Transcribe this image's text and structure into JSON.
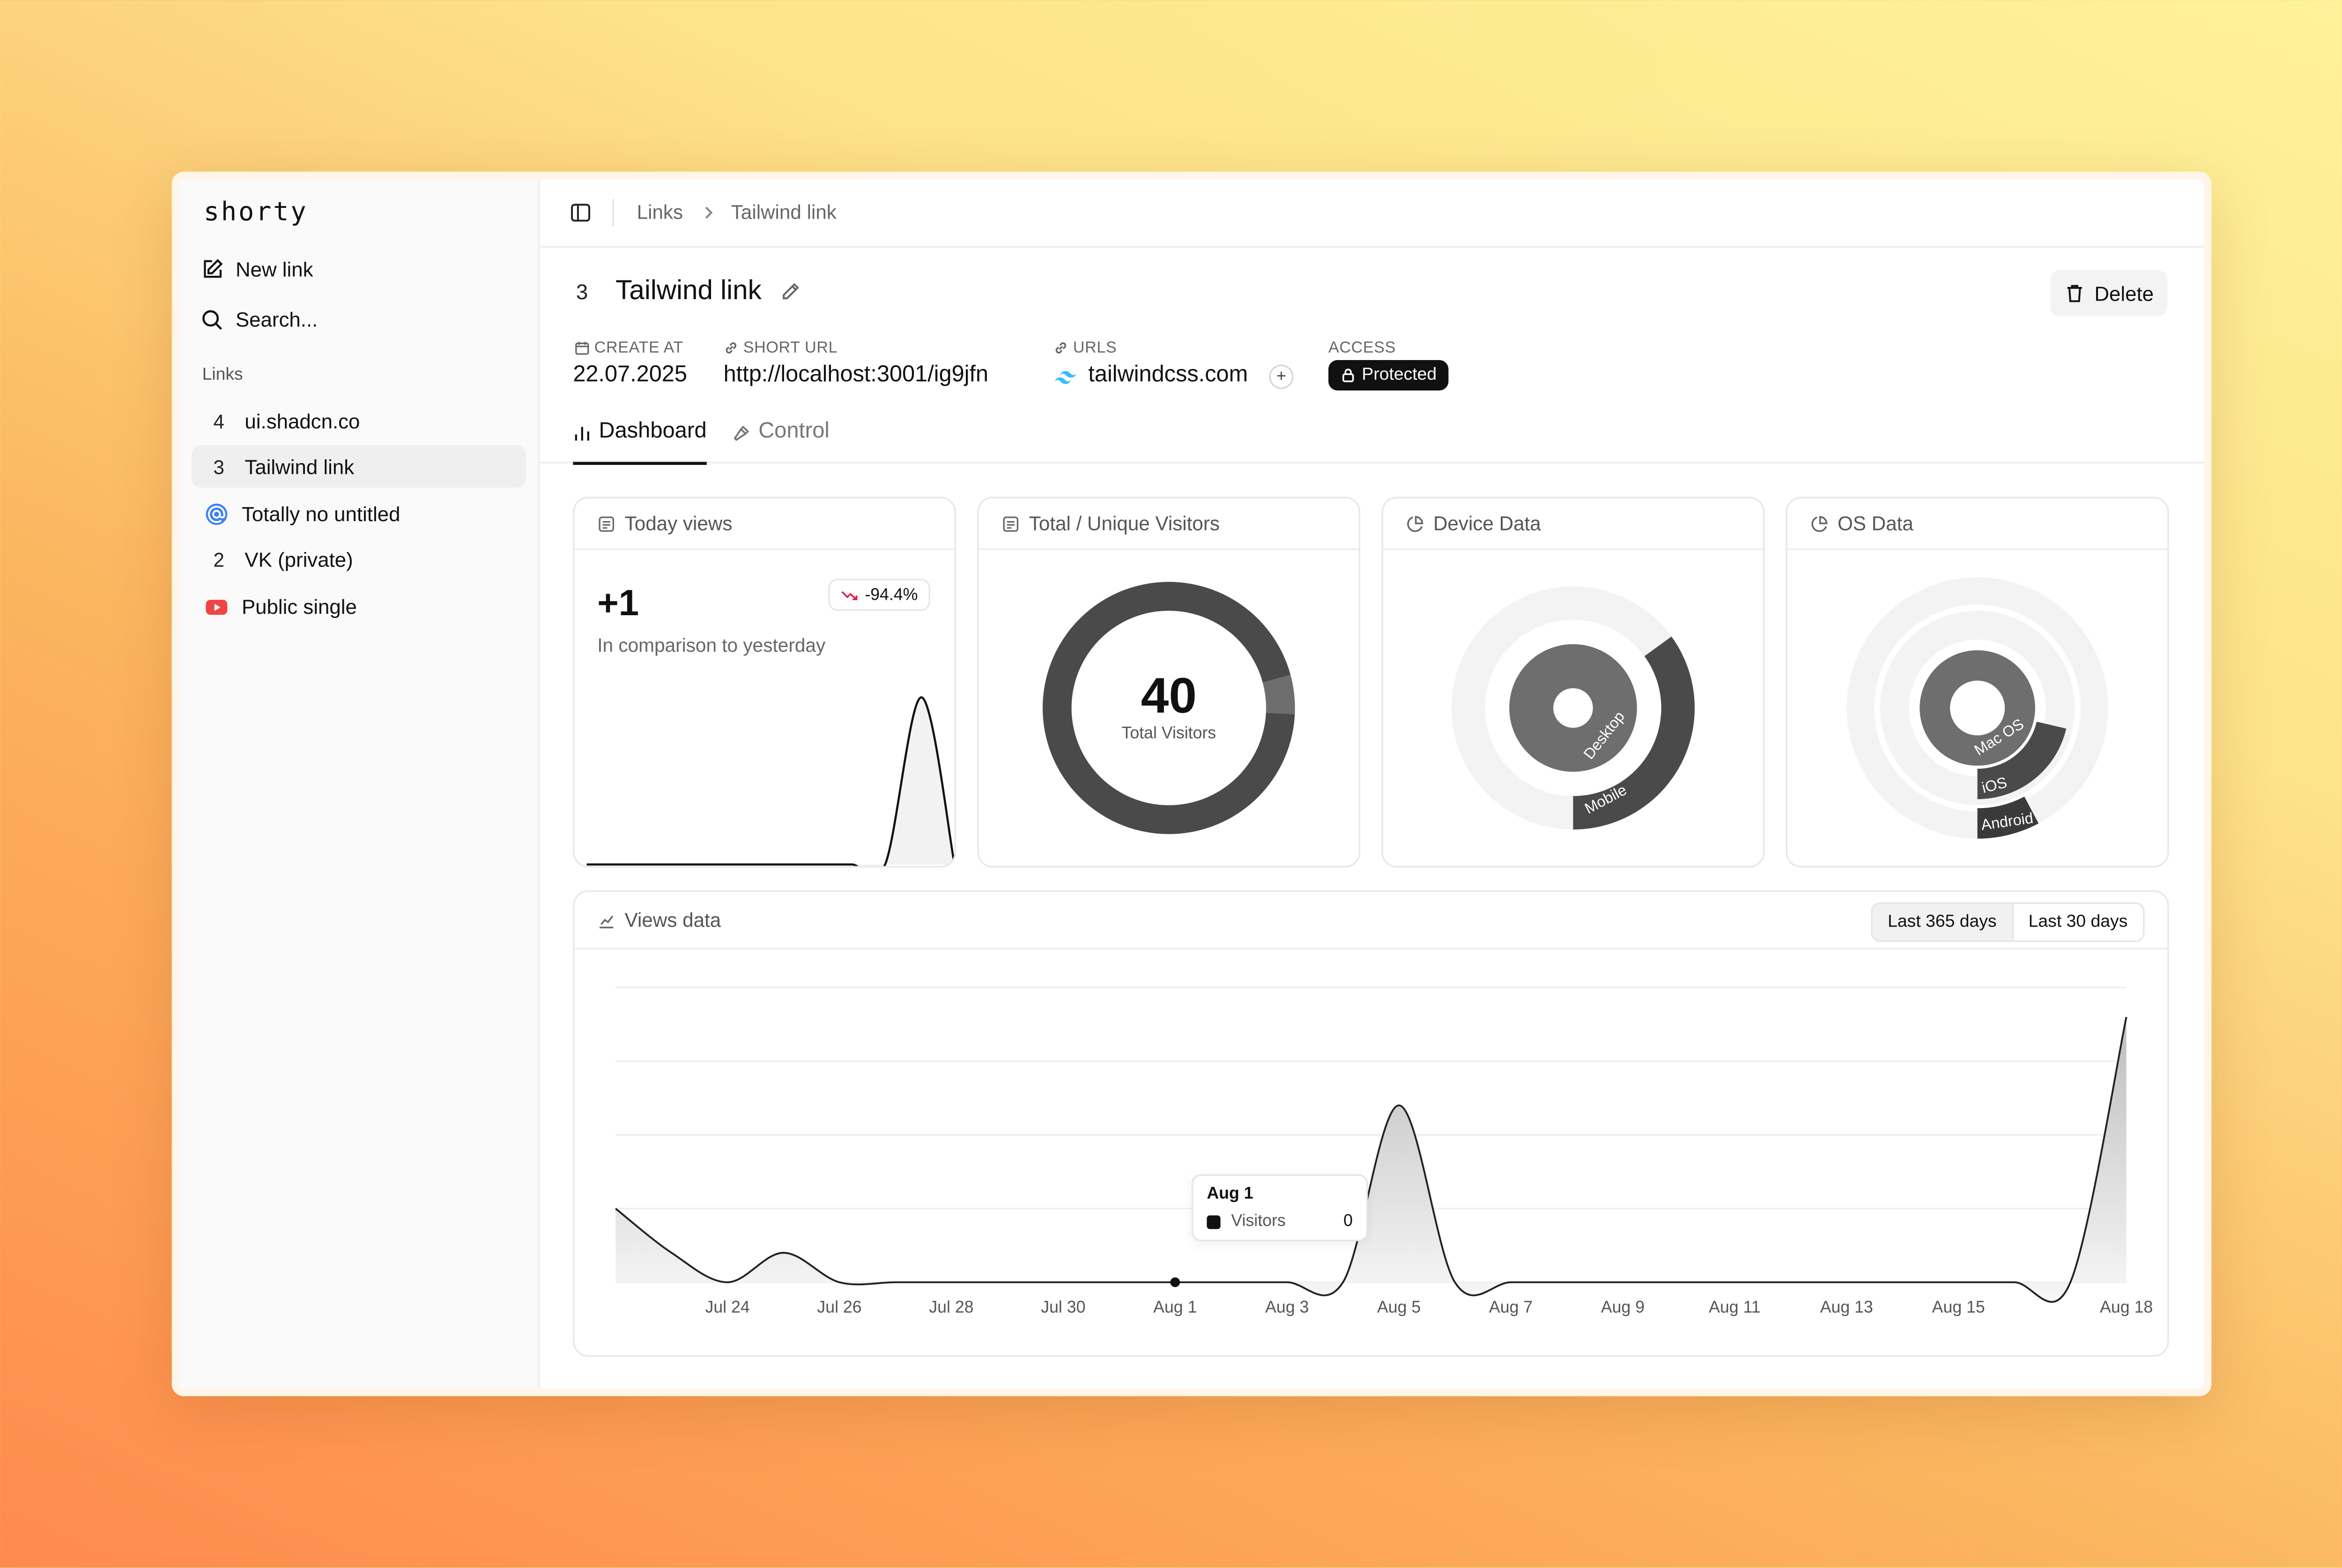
{
  "app": {
    "brand": "shorty"
  },
  "sidebar": {
    "new_link": "New link",
    "search": "Search...",
    "group_label": "Links",
    "items": [
      {
        "badge": "4",
        "label": "ui.shadcn.co",
        "icon": "number"
      },
      {
        "badge": "3",
        "label": "Tailwind link",
        "icon": "number",
        "active": true
      },
      {
        "badge": "",
        "label": "Totally no untitled",
        "icon": "at-sign-icon"
      },
      {
        "badge": "2",
        "label": "VK (private)",
        "icon": "number"
      },
      {
        "badge": "",
        "label": "Public single",
        "icon": "youtube-icon"
      }
    ]
  },
  "breadcrumb": {
    "parent": "Links",
    "current": "Tailwind link"
  },
  "link": {
    "number": "3",
    "title": "Tailwind link",
    "delete_label": "Delete",
    "meta": {
      "create_label": "CREATE AT",
      "create_value": "22.07.2025",
      "short_label": "SHORT URL",
      "short_value": "http://localhost:3001/ig9jfn",
      "urls_label": "URLS",
      "urls_value": "tailwindcss.com",
      "access_label": "ACCESS",
      "access_value": "Protected"
    }
  },
  "tabs": [
    {
      "label": "Dashboard",
      "active": true
    },
    {
      "label": "Control",
      "active": false
    }
  ],
  "cards": {
    "today": {
      "title": "Today views",
      "value": "+1",
      "delta": "-94.4%",
      "caption": "In comparison to yesterday"
    },
    "visitors": {
      "title": "Total / Unique Visitors",
      "total": "40",
      "caption": "Total Visitors"
    },
    "device": {
      "title": "Device Data"
    },
    "os": {
      "title": "OS Data"
    }
  },
  "views": {
    "title": "Views data",
    "ranges": [
      {
        "label": "Last 365 days",
        "active": true
      },
      {
        "label": "Last 30 days",
        "active": false
      }
    ],
    "tooltip": {
      "date": "Aug 1",
      "series": "Visitors",
      "value": "0"
    }
  },
  "colors": {
    "dark": "#111111",
    "mid": "#4a4a4a",
    "gray": "#6e6e6e",
    "light": "#f2f2f2",
    "accent_red": "#e11d48",
    "link_blue": "#38bdf8"
  },
  "chart_data": [
    {
      "type": "area",
      "title": "Today views",
      "series": [
        {
          "values": [
            0,
            0,
            0,
            0,
            0,
            0,
            0,
            0,
            0,
            0,
            1,
            0
          ]
        }
      ]
    },
    {
      "type": "pie",
      "title": "Total / Unique Visitors",
      "total": 40,
      "slices": [
        {
          "label": "",
          "value": 38
        },
        {
          "label": "",
          "value": 2
        }
      ]
    },
    {
      "type": "pie",
      "title": "Device Data",
      "slices": [
        {
          "label": "Desktop",
          "value": 26
        },
        {
          "label": "Mobile",
          "value": 14
        }
      ]
    },
    {
      "type": "pie",
      "title": "OS Data",
      "slices": [
        {
          "label": "Mac OS",
          "value": 26
        },
        {
          "label": "iOS",
          "value": 9
        },
        {
          "label": "Android",
          "value": 5
        }
      ]
    },
    {
      "type": "area",
      "title": "Views data",
      "x_ticks": [
        "Jul 24",
        "Jul 26",
        "Jul 28",
        "Jul 30",
        "Aug 1",
        "Aug 3",
        "Aug 5",
        "Aug 7",
        "Aug 9",
        "Aug 11",
        "Aug 13",
        "Aug 15",
        "Aug 18"
      ],
      "x": [
        "Jul 22",
        "Jul 23",
        "Jul 24",
        "Jul 25",
        "Jul 26",
        "Jul 27",
        "Jul 28",
        "Jul 29",
        "Jul 30",
        "Jul 31",
        "Aug 1",
        "Aug 2",
        "Aug 3",
        "Aug 4",
        "Aug 5",
        "Aug 6",
        "Aug 7",
        "Aug 8",
        "Aug 9",
        "Aug 10",
        "Aug 11",
        "Aug 12",
        "Aug 13",
        "Aug 14",
        "Aug 15",
        "Aug 16",
        "Aug 17",
        "Aug 18"
      ],
      "series": [
        {
          "name": "Visitors",
          "values": [
            5,
            2,
            0,
            2,
            0,
            0,
            0,
            0,
            0,
            0,
            0,
            0,
            0,
            0,
            12,
            0,
            0,
            0,
            0,
            0,
            0,
            0,
            0,
            0,
            0,
            0,
            0,
            18
          ]
        }
      ],
      "ylim": [
        0,
        20
      ],
      "grid": true
    }
  ]
}
